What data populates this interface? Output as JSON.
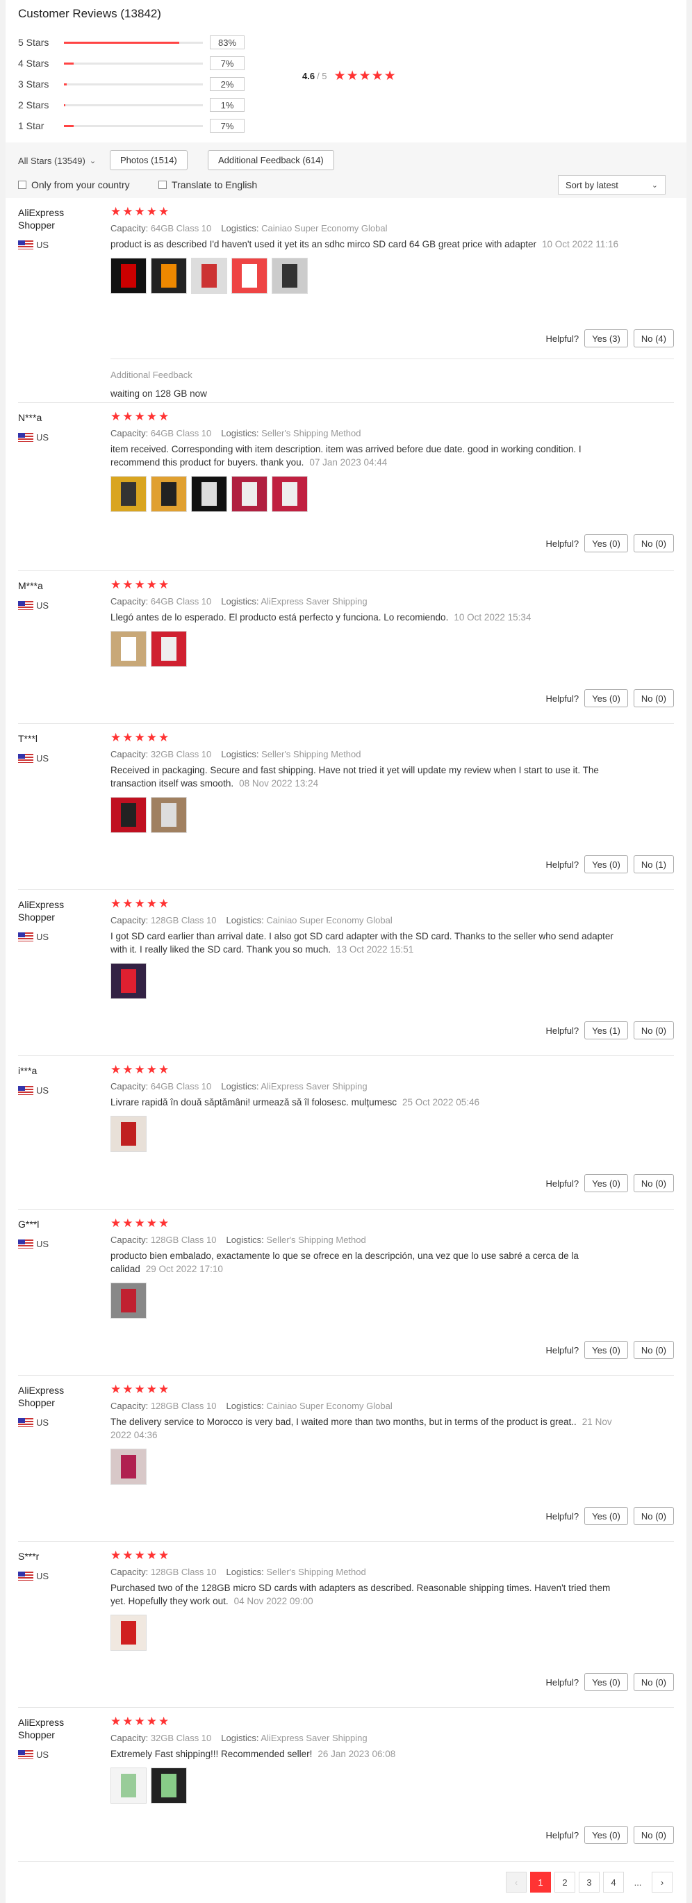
{
  "header": {
    "title": "Customer Reviews (13842)",
    "distribution": [
      {
        "label": "5 Stars",
        "pct": "83%",
        "fill": 0.83
      },
      {
        "label": "4 Stars",
        "pct": "7%",
        "fill": 0.07
      },
      {
        "label": "3 Stars",
        "pct": "2%",
        "fill": 0.02
      },
      {
        "label": "2 Stars",
        "pct": "1%",
        "fill": 0.01
      },
      {
        "label": "1 Star",
        "pct": "7%",
        "fill": 0.07
      }
    ],
    "average": "4.6",
    "max": "/ 5",
    "stars": "★★★★★"
  },
  "filters": {
    "all_stars": "All Stars (13549)",
    "photos": "Photos (1514)",
    "additional": "Additional Feedback (614)",
    "only_country": "Only from your country",
    "translate": "Translate to English",
    "sort": "Sort by latest"
  },
  "labels": {
    "capacity": "Capacity:",
    "logistics": "Logistics:",
    "helpful": "Helpful?",
    "additional_feedback": "Additional Feedback"
  },
  "reviews": [
    {
      "name": "AliExpress Shopper",
      "country": "US",
      "stars": "★★★★★",
      "capacity": "64GB Class 10",
      "logistics": "Cainiao Super Economy Global",
      "text": "product is as described I'd haven't used it yet its an sdhc mirco SD card 64 GB great price with adapter",
      "date": "10 Oct 2022 11:16",
      "yes": "Yes (3)",
      "no": "No (4)",
      "additional": "waiting on 128 GB now",
      "thumbs": [
        [
          "#111",
          "#c00"
        ],
        [
          "#222",
          "#e80"
        ],
        [
          "#ddd",
          "#c33"
        ],
        [
          "#e44",
          "#fff"
        ],
        [
          "#ccc",
          "#333"
        ]
      ]
    },
    {
      "name": "N***a",
      "country": "US",
      "stars": "★★★★★",
      "capacity": "64GB Class 10",
      "logistics": "Seller's Shipping Method",
      "text": "item received. Corresponding with item description. item was arrived before due date. good in working condition. I recommend this product for buyers. thank you.",
      "date": "07 Jan 2023 04:44",
      "yes": "Yes (0)",
      "no": "No (0)",
      "thumbs": [
        [
          "#d9a520",
          "#333"
        ],
        [
          "#e0a030",
          "#222"
        ],
        [
          "#111",
          "#ddd"
        ],
        [
          "#b02040",
          "#eee"
        ],
        [
          "#c02040",
          "#eee"
        ]
      ]
    },
    {
      "name": "M***a",
      "country": "US",
      "stars": "★★★★★",
      "capacity": "64GB Class 10",
      "logistics": "AliExpress Saver Shipping",
      "text": "Llegó antes de lo esperado. El producto está perfecto y funciona. Lo recomiendo.",
      "date": "10 Oct 2022 15:34",
      "yes": "Yes (0)",
      "no": "No (0)",
      "thumbs": [
        [
          "#c8a878",
          "#fff"
        ],
        [
          "#d02030",
          "#eee"
        ]
      ]
    },
    {
      "name": "T***l",
      "country": "US",
      "stars": "★★★★★",
      "capacity": "32GB Class 10",
      "logistics": "Seller's Shipping Method",
      "text": "Received in packaging. Secure and fast shipping. Have not tried it yet will update my review when I start to use it. The transaction itself was smooth.",
      "date": "08 Nov 2022 13:24",
      "yes": "Yes (0)",
      "no": "No (1)",
      "thumbs": [
        [
          "#c01020",
          "#222"
        ],
        [
          "#a08060",
          "#ddd"
        ]
      ]
    },
    {
      "name": "AliExpress Shopper",
      "country": "US",
      "stars": "★★★★★",
      "capacity": "128GB Class 10",
      "logistics": "Cainiao Super Economy Global",
      "text": "I got SD card earlier than arrival date. I also got SD card adapter with the SD card. Thanks to the seller who send adapter with it. I really liked the SD card. Thank you so much.",
      "date": "13 Oct 2022 15:51",
      "yes": "Yes (1)",
      "no": "No (0)",
      "thumbs": [
        [
          "#332244",
          "#e02030"
        ]
      ]
    },
    {
      "name": "i***a",
      "country": "US",
      "stars": "★★★★★",
      "capacity": "64GB Class 10",
      "logistics": "AliExpress Saver Shipping",
      "text": "Livrare rapidă în două săptămâni! urmează să îl folosesc. mulțumesc",
      "date": "25 Oct 2022 05:46",
      "yes": "Yes (0)",
      "no": "No (0)",
      "thumbs": [
        [
          "#e8e0d8",
          "#c02020"
        ]
      ]
    },
    {
      "name": "G***l",
      "country": "US",
      "stars": "★★★★★",
      "capacity": "128GB Class 10",
      "logistics": "Seller's Shipping Method",
      "text": "producto bien embalado, exactamente lo que se ofrece en la descripción, una vez que lo use sabré a cerca de la calidad",
      "date": "29 Oct 2022 17:10",
      "yes": "Yes (0)",
      "no": "No (0)",
      "thumbs": [
        [
          "#888",
          "#c02030"
        ]
      ]
    },
    {
      "name": "AliExpress Shopper",
      "country": "US",
      "stars": "★★★★★",
      "capacity": "128GB Class 10",
      "logistics": "Cainiao Super Economy Global",
      "text": "The delivery service to Morocco is very bad, I waited more than two months, but in terms of the product is great..",
      "date": "21 Nov 2022 04:36",
      "yes": "Yes (0)",
      "no": "No (0)",
      "thumbs": [
        [
          "#d8c8c8",
          "#b02050"
        ]
      ]
    },
    {
      "name": "S***r",
      "country": "US",
      "stars": "★★★★★",
      "capacity": "128GB Class 10",
      "logistics": "Seller's Shipping Method",
      "text": "Purchased two of the 128GB micro SD cards with adapters as described. Reasonable shipping times. Haven't tried them yet. Hopefully they work out.",
      "date": "04 Nov 2022 09:00",
      "yes": "Yes (0)",
      "no": "No (0)",
      "thumbs": [
        [
          "#f0e8e0",
          "#d02020"
        ]
      ]
    },
    {
      "name": "AliExpress Shopper",
      "country": "US",
      "stars": "★★★★★",
      "capacity": "32GB Class 10",
      "logistics": "AliExpress Saver Shipping",
      "text": "Extremely Fast shipping!!! Recommended seller!",
      "date": "26 Jan 2023 06:08",
      "yes": "Yes (0)",
      "no": "No (0)",
      "thumbs": [
        [
          "#f4f4f4",
          "#9c9"
        ],
        [
          "#222",
          "#8c8"
        ]
      ]
    }
  ],
  "pagination": {
    "prev": "‹",
    "pages": [
      "1",
      "2",
      "3",
      "4"
    ],
    "dots": "...",
    "next": "›"
  }
}
